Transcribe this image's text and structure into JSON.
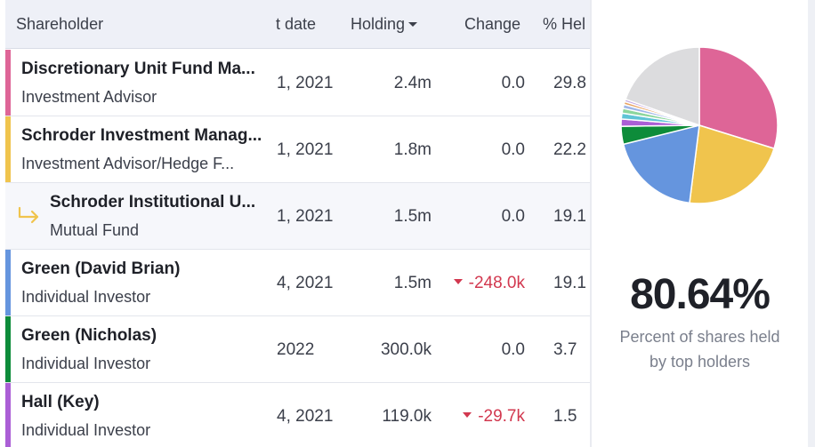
{
  "table": {
    "headers": {
      "shareholder": "Shareholder",
      "date": "t date",
      "holding": "Holding",
      "change": "Change",
      "pct": "% Hel"
    },
    "rows": [
      {
        "name": "Discretionary Unit Fund Ma...",
        "type": "Investment Advisor",
        "date": "1, 2021",
        "holding": "2.4m",
        "change": "0.0",
        "pct": "29.8",
        "color": "#de6597",
        "sub": false,
        "neg": false
      },
      {
        "name": "Schroder Investment Manag...",
        "type": "Investment Advisor/Hedge F...",
        "date": "1, 2021",
        "holding": "1.8m",
        "change": "0.0",
        "pct": "22.2",
        "color": "#f0c44d",
        "sub": false,
        "neg": false
      },
      {
        "name": "Schroder Institutional U...",
        "type": "Mutual Fund",
        "date": "1, 2021",
        "holding": "1.5m",
        "change": "0.0",
        "pct": "19.1",
        "color": "#f0c44d",
        "sub": true,
        "neg": false
      },
      {
        "name": "Green (David Brian)",
        "type": "Individual Investor",
        "date": "4, 2021",
        "holding": "1.5m",
        "change": "-248.0k",
        "pct": "19.1",
        "color": "#6595de",
        "sub": false,
        "neg": true
      },
      {
        "name": "Green (Nicholas)",
        "type": "Individual Investor",
        "date": "2022",
        "holding": "300.0k",
        "change": "0.0",
        "pct": "3.7",
        "color": "#0d8c3a",
        "sub": false,
        "neg": false
      },
      {
        "name": "Hall (Key)",
        "type": "Individual Investor",
        "date": "4, 2021",
        "holding": "119.0k",
        "change": "-29.7k",
        "pct": "1.5",
        "color": "#ab5fd6",
        "sub": false,
        "neg": true
      }
    ]
  },
  "summary": {
    "percent": "80.64%",
    "caption": "Percent of shares held by top holders"
  },
  "chart_data": {
    "type": "pie",
    "values": [
      29.8,
      22.2,
      19.1,
      3.7,
      1.5,
      1.2,
      1.0,
      0.8,
      0.6,
      0.5,
      19.6
    ],
    "colors": [
      "#de6597",
      "#f0c44d",
      "#6595de",
      "#0d8c3a",
      "#ab5fd6",
      "#5fc4d6",
      "#8bd69d",
      "#9fb6e8",
      "#e8a25f",
      "#c0a4e0",
      "#dcdcde"
    ]
  }
}
